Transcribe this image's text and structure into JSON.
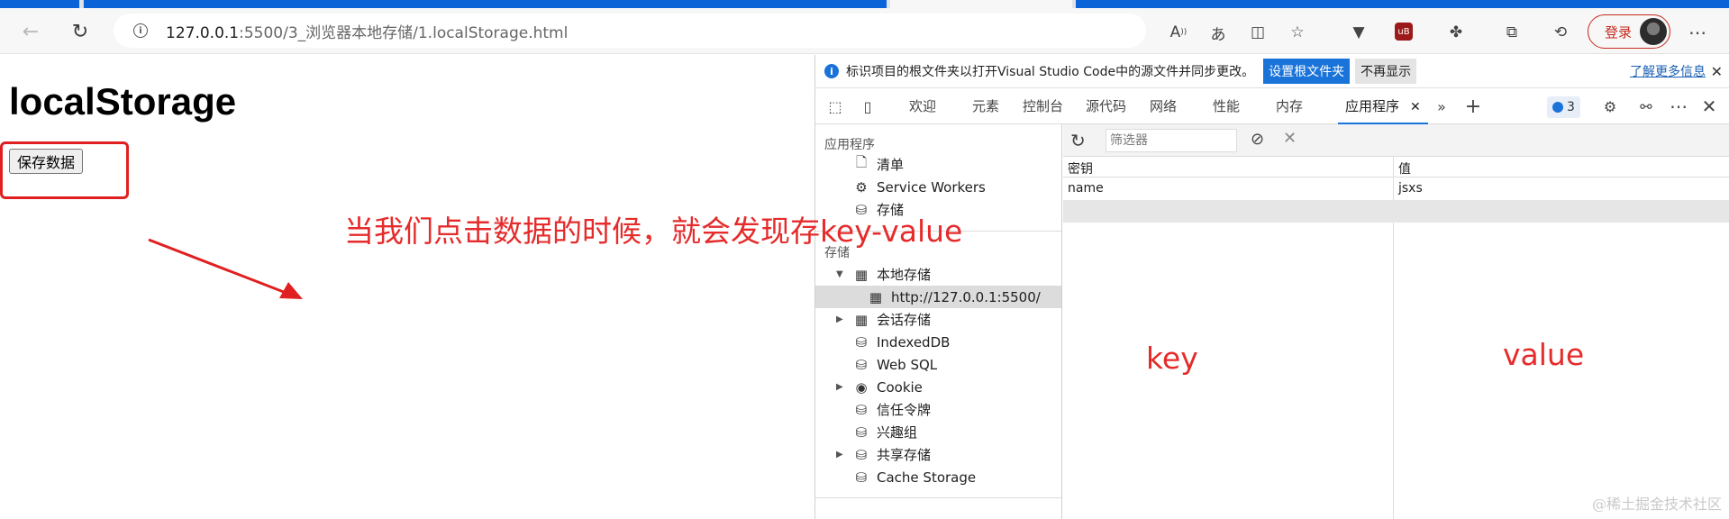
{
  "browser": {
    "url_host": "127.0.0.1",
    "url_rest": ":5500/3_浏览器本地存储/1.localStorage.html",
    "login_label": "登录"
  },
  "page": {
    "heading": "localStorage",
    "save_button": "保存数据",
    "annotation": "当我们点击数据的时候，就会发现存key-value"
  },
  "devtools": {
    "infobar": {
      "message": "标识项目的根文件夹以打开Visual Studio Code中的源文件并同步更改。",
      "primary_button": "设置根文件夹",
      "secondary_button": "不再显示",
      "learn_more": "了解更多信息"
    },
    "tabs": [
      "欢迎",
      "元素",
      "控制台",
      "源代码",
      "网络",
      "性能",
      "内存",
      "应用程序"
    ],
    "active_tab": "应用程序",
    "issues_count": "3",
    "sidebar": {
      "app_section": "应用程序",
      "app_items": [
        "清单",
        "Service Workers",
        "存储"
      ],
      "storage_section": "存储",
      "storage_items": [
        "本地存储",
        "http://127.0.0.1:5500/",
        "会话存储",
        "IndexedDB",
        "Web SQL",
        "Cookie",
        "信任令牌",
        "兴趣组",
        "共享存储",
        "Cache Storage"
      ]
    },
    "filter_placeholder": "筛选器",
    "table": {
      "col_key": "密钥",
      "col_value": "值",
      "rows": [
        {
          "key": "name",
          "value": "jsxs"
        }
      ]
    },
    "labels": {
      "key": "key",
      "value": "value"
    }
  },
  "watermark": "@稀土掘金技术社区",
  "colors": {
    "accent": "#1a73d9",
    "annotation": "#e52b2b"
  }
}
